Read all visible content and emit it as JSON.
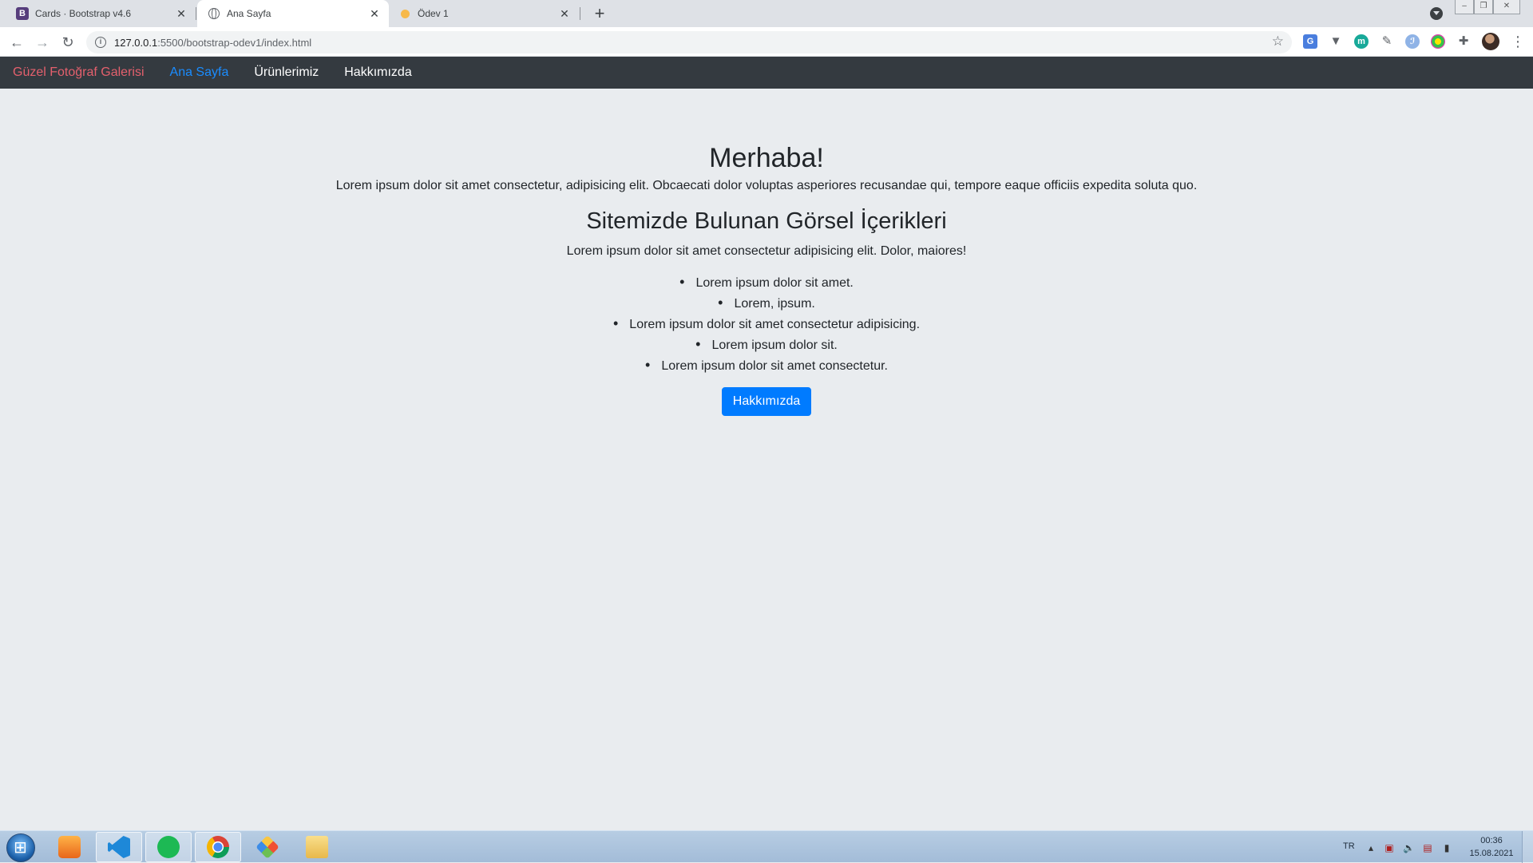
{
  "browser": {
    "tabs": [
      {
        "title": "Cards · Bootstrap v4.6",
        "favicon": "bootstrap-icon",
        "active": false
      },
      {
        "title": "Ana Sayfa",
        "favicon": "globe-icon",
        "active": true
      },
      {
        "title": "Ödev 1",
        "favicon": "loading-dot-icon",
        "active": false
      }
    ],
    "url_host": "127.0.0.1",
    "url_rest": ":5500/bootstrap-odev1/index.html"
  },
  "navbar": {
    "brand": "Güzel Fotoğraf Galerisi",
    "links": [
      {
        "label": "Ana Sayfa",
        "active": true
      },
      {
        "label": "Ürünlerimiz",
        "active": false
      },
      {
        "label": "Hakkımızda",
        "active": false
      }
    ]
  },
  "main": {
    "heading": "Merhaba!",
    "lead": "Lorem ipsum dolor sit amet consectetur, adipisicing elit. Obcaecati dolor voluptas asperiores recusandae qui, tempore eaque officiis expedita soluta quo.",
    "subheading": "Sitemizde Bulunan Görsel İçerikleri",
    "subtext": "Lorem ipsum dolor sit amet consectetur adipisicing elit. Dolor, maiores!",
    "items": [
      "Lorem ipsum dolor sit amet.",
      "Lorem, ipsum.",
      "Lorem ipsum dolor sit amet consectetur adipisicing.",
      "Lorem ipsum dolor sit.",
      "Lorem ipsum dolor sit amet consectetur."
    ],
    "button_label": "Hakkımızda"
  },
  "taskbar": {
    "language": "TR",
    "time": "00:36",
    "date": "15.08.2021"
  },
  "colors": {
    "navbar_bg": "#343a40",
    "brand": "#e4606d",
    "active_link": "#1a8cff",
    "button": "#007bff",
    "page_bg": "#e9ecef"
  }
}
